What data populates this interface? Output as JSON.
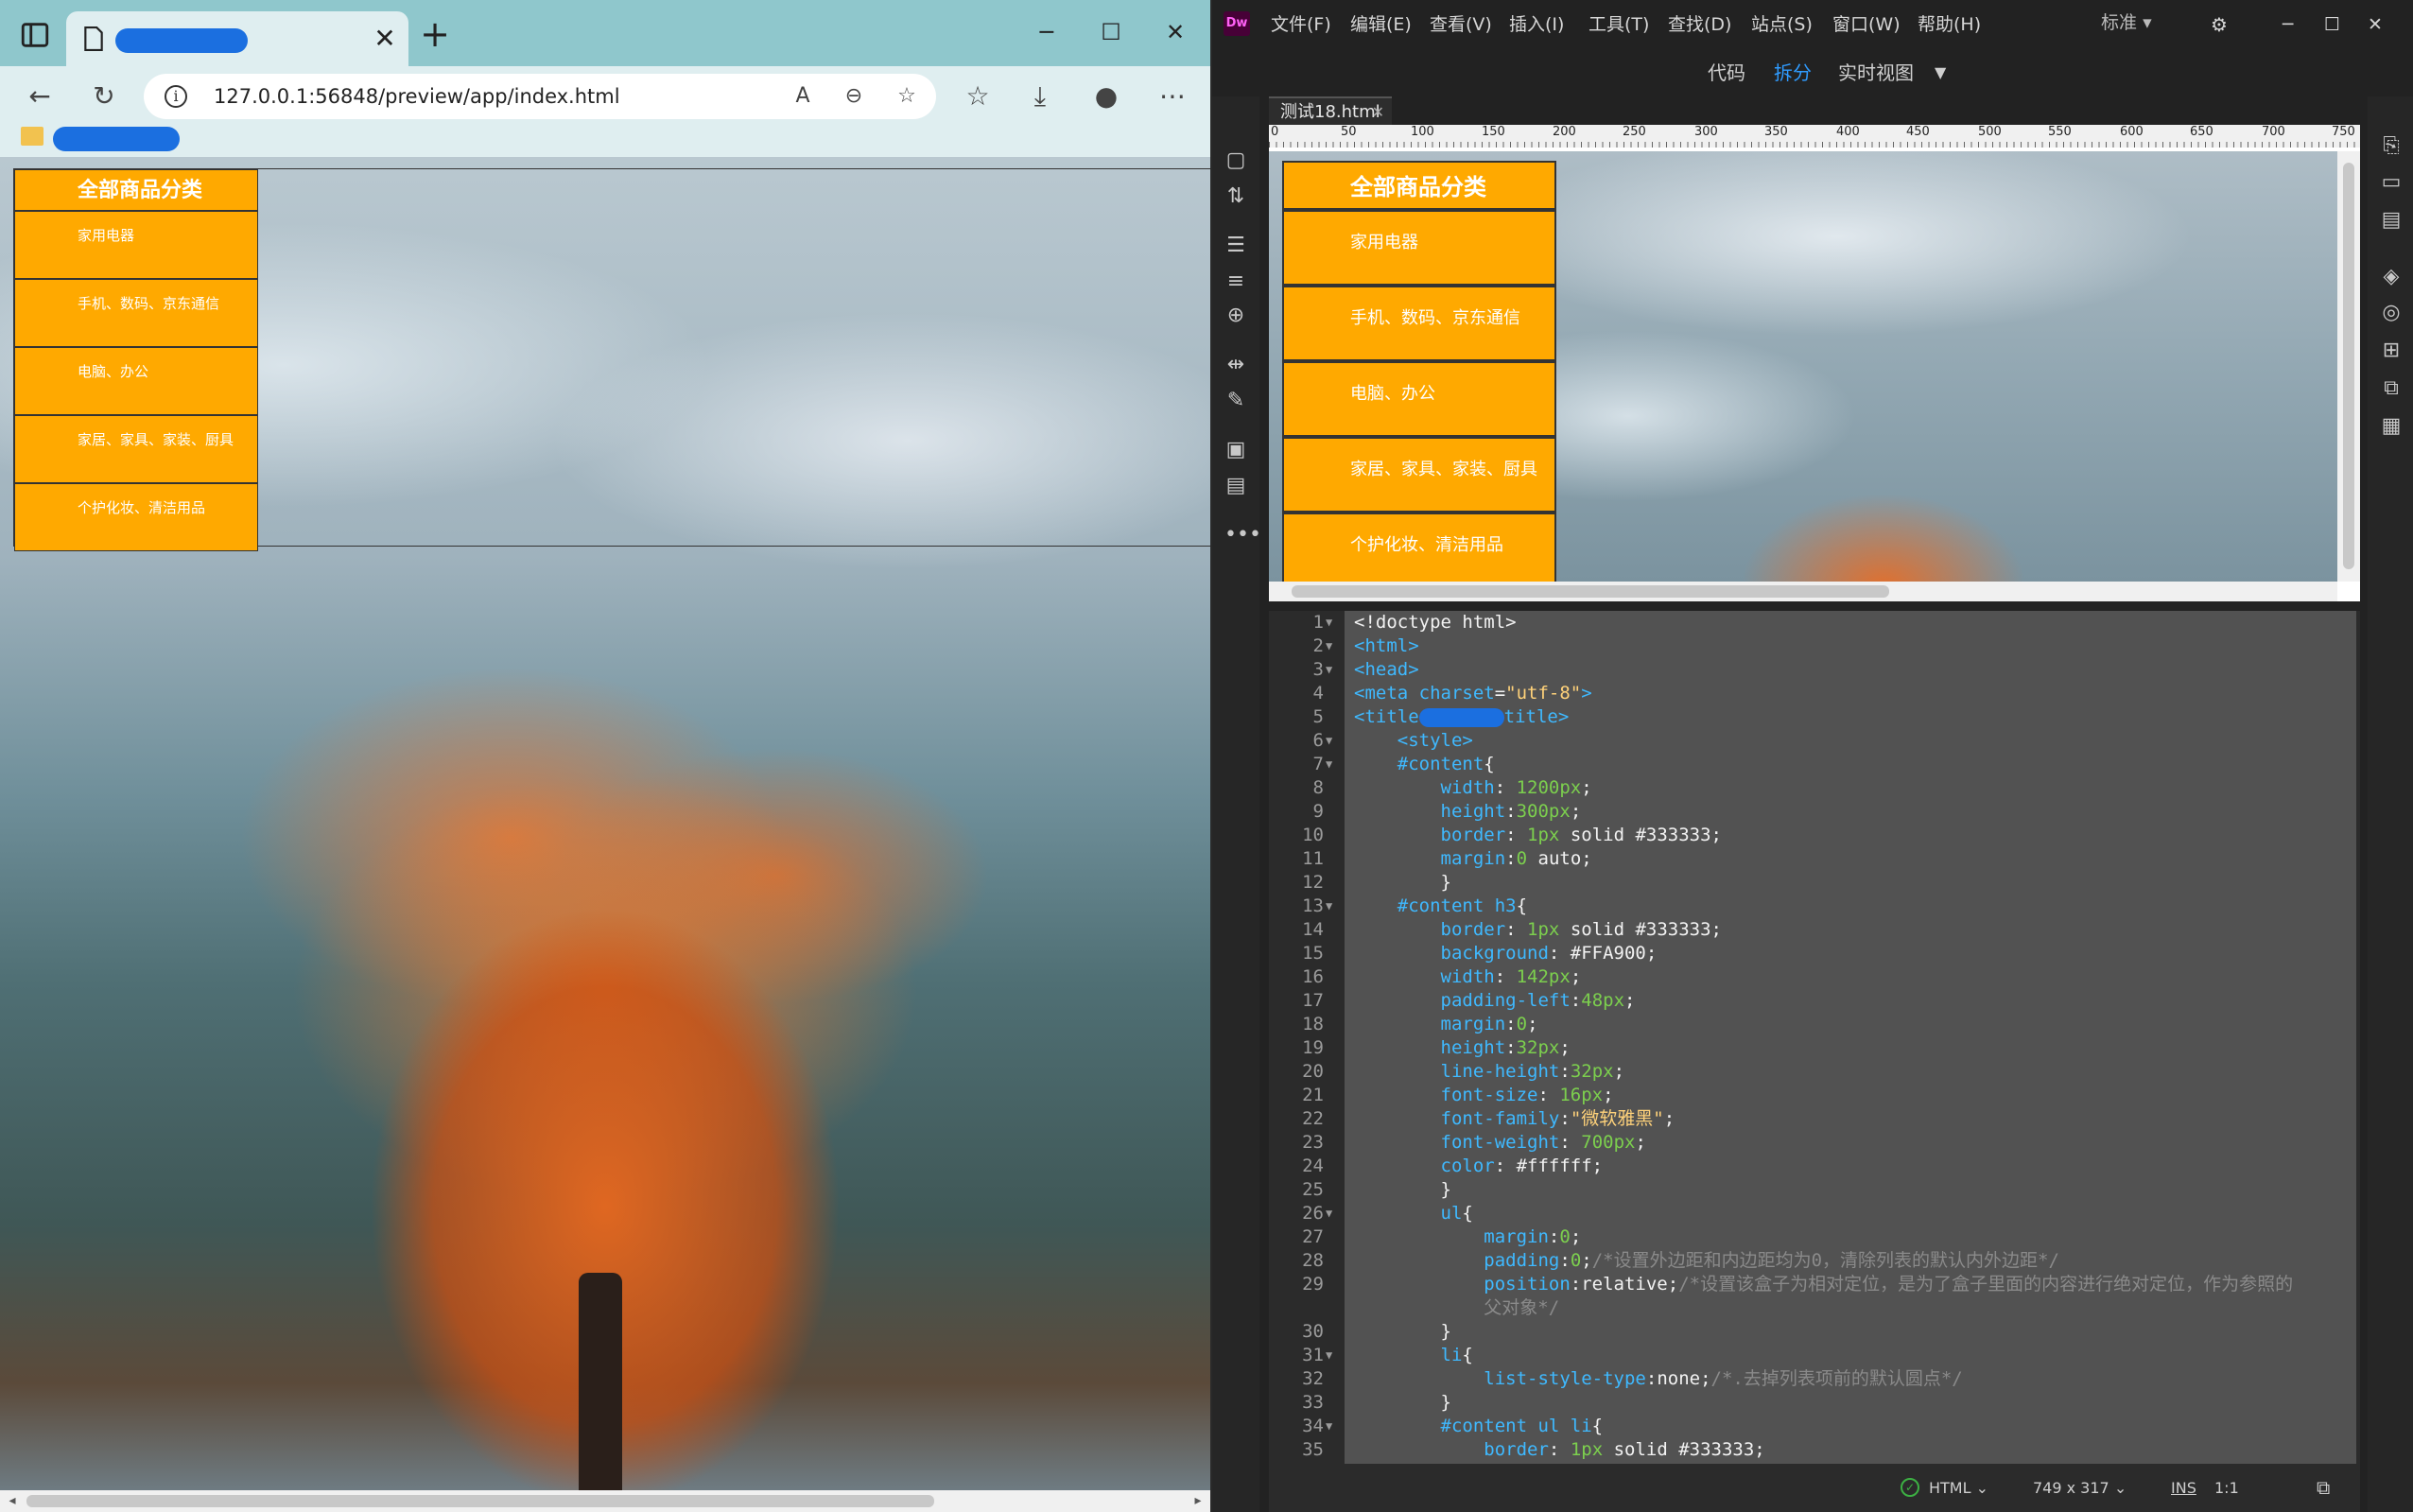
{
  "browser": {
    "address_url": "127.0.0.1:56848/preview/app/index.html",
    "tab_close": "✕",
    "new_tab": "+",
    "win_min": "─",
    "win_max": "☐",
    "win_close": "✕",
    "icons": {
      "back": "back-arrow-icon",
      "refresh": "refresh-icon",
      "info": "site-info-icon",
      "read_aloud": "read-aloud-icon",
      "zoom": "zoom-out-icon",
      "favorite": "add-favorite-icon",
      "favorites": "favorites-icon",
      "download": "download-icon",
      "profile": "profile-icon",
      "more": "more-icon"
    }
  },
  "page": {
    "heading": "全部商品分类",
    "items": [
      "家用电器",
      "手机、数码、京东通信",
      "电脑、办公",
      "家居、家具、家装、厨具",
      "个护化妆、清洁用品"
    ],
    "colors": {
      "nav_bg": "#FFA900",
      "border": "#333333",
      "text": "#ffffff"
    }
  },
  "dw": {
    "menus": [
      "文件(F)",
      "编辑(E)",
      "查看(V)",
      "插入(I)",
      "工具(T)",
      "查找(D)",
      "站点(S)",
      "窗口(W)",
      "帮助(H)"
    ],
    "workspace": "标准",
    "views": [
      "代码",
      "拆分",
      "实时视图"
    ],
    "active_view": "拆分",
    "doc_tab": "测试18.html",
    "ruler_ticks": [
      "0",
      "50",
      "100",
      "150",
      "200",
      "250",
      "300",
      "350",
      "400",
      "450",
      "500",
      "550",
      "600",
      "650",
      "700",
      "750"
    ],
    "status": {
      "language": "HTML",
      "dimensions": "749 x 317",
      "mode": "INS",
      "position": "1:1"
    },
    "code_lines": [
      {
        "n": "1",
        "fold": true,
        "parts": [
          [
            "t-white",
            "<!doctype html>"
          ]
        ]
      },
      {
        "n": "2",
        "fold": true,
        "parts": [
          [
            "t-tag",
            "<html>"
          ]
        ]
      },
      {
        "n": "3",
        "fold": true,
        "parts": [
          [
            "t-tag",
            "<head>"
          ]
        ]
      },
      {
        "n": "4",
        "fold": false,
        "parts": [
          [
            "t-tag",
            "<meta "
          ],
          [
            "t-prop",
            "charset"
          ],
          [
            "t-white",
            "="
          ],
          [
            "t-str",
            "\"utf-8\""
          ],
          [
            "t-tag",
            ">"
          ]
        ]
      },
      {
        "n": "5",
        "fold": false,
        "parts": [
          [
            "t-tag",
            "<title"
          ],
          [
            "redact",
            ""
          ],
          [
            "t-tag",
            "title>"
          ]
        ]
      },
      {
        "n": "6",
        "fold": true,
        "parts": [
          [
            "t-white",
            "    "
          ],
          [
            "t-tag",
            "<style>"
          ]
        ]
      },
      {
        "n": "7",
        "fold": true,
        "parts": [
          [
            "t-white",
            "    "
          ],
          [
            "t-tag",
            "#content"
          ],
          [
            "t-white",
            "{"
          ]
        ]
      },
      {
        "n": "8",
        "fold": false,
        "parts": [
          [
            "t-white",
            "        "
          ],
          [
            "t-prop",
            "width"
          ],
          [
            "t-white",
            ": "
          ],
          [
            "t-num",
            "1200px"
          ],
          [
            "t-white",
            ";"
          ]
        ]
      },
      {
        "n": "9",
        "fold": false,
        "parts": [
          [
            "t-white",
            "        "
          ],
          [
            "t-prop",
            "height"
          ],
          [
            "t-white",
            ":"
          ],
          [
            "t-num",
            "300px"
          ],
          [
            "t-white",
            ";"
          ]
        ]
      },
      {
        "n": "10",
        "fold": false,
        "parts": [
          [
            "t-white",
            "        "
          ],
          [
            "t-prop",
            "border"
          ],
          [
            "t-white",
            ": "
          ],
          [
            "t-num",
            "1px"
          ],
          [
            "t-white",
            " solid #333333;"
          ]
        ]
      },
      {
        "n": "11",
        "fold": false,
        "parts": [
          [
            "t-white",
            "        "
          ],
          [
            "t-prop",
            "margin"
          ],
          [
            "t-white",
            ":"
          ],
          [
            "t-num",
            "0"
          ],
          [
            "t-white",
            " auto;"
          ]
        ]
      },
      {
        "n": "12",
        "fold": false,
        "parts": [
          [
            "t-white",
            "        }"
          ]
        ]
      },
      {
        "n": "13",
        "fold": true,
        "parts": [
          [
            "t-white",
            "    "
          ],
          [
            "t-tag",
            "#content h3"
          ],
          [
            "t-white",
            "{"
          ]
        ]
      },
      {
        "n": "14",
        "fold": false,
        "parts": [
          [
            "t-white",
            "        "
          ],
          [
            "t-prop",
            "border"
          ],
          [
            "t-white",
            ": "
          ],
          [
            "t-num",
            "1px"
          ],
          [
            "t-white",
            " solid #333333;"
          ]
        ]
      },
      {
        "n": "15",
        "fold": false,
        "parts": [
          [
            "t-white",
            "        "
          ],
          [
            "t-prop",
            "background"
          ],
          [
            "t-white",
            ": #FFA900;"
          ]
        ]
      },
      {
        "n": "16",
        "fold": false,
        "parts": [
          [
            "t-white",
            "        "
          ],
          [
            "t-prop",
            "width"
          ],
          [
            "t-white",
            ": "
          ],
          [
            "t-num",
            "142px"
          ],
          [
            "t-white",
            ";"
          ]
        ]
      },
      {
        "n": "17",
        "fold": false,
        "parts": [
          [
            "t-white",
            "        "
          ],
          [
            "t-prop",
            "padding-left"
          ],
          [
            "t-white",
            ":"
          ],
          [
            "t-num",
            "48px"
          ],
          [
            "t-white",
            ";"
          ]
        ]
      },
      {
        "n": "18",
        "fold": false,
        "parts": [
          [
            "t-white",
            "        "
          ],
          [
            "t-prop",
            "margin"
          ],
          [
            "t-white",
            ":"
          ],
          [
            "t-num",
            "0"
          ],
          [
            "t-white",
            ";"
          ]
        ]
      },
      {
        "n": "19",
        "fold": false,
        "parts": [
          [
            "t-white",
            "        "
          ],
          [
            "t-prop",
            "height"
          ],
          [
            "t-white",
            ":"
          ],
          [
            "t-num",
            "32px"
          ],
          [
            "t-white",
            ";"
          ]
        ]
      },
      {
        "n": "20",
        "fold": false,
        "parts": [
          [
            "t-white",
            "        "
          ],
          [
            "t-prop",
            "line-height"
          ],
          [
            "t-white",
            ":"
          ],
          [
            "t-num",
            "32px"
          ],
          [
            "t-white",
            ";"
          ]
        ]
      },
      {
        "n": "21",
        "fold": false,
        "parts": [
          [
            "t-white",
            "        "
          ],
          [
            "t-prop",
            "font-size"
          ],
          [
            "t-white",
            ": "
          ],
          [
            "t-num",
            "16px"
          ],
          [
            "t-white",
            ";"
          ]
        ]
      },
      {
        "n": "22",
        "fold": false,
        "parts": [
          [
            "t-white",
            "        "
          ],
          [
            "t-prop",
            "font-family"
          ],
          [
            "t-white",
            ":"
          ],
          [
            "t-str",
            "\"微软雅黑\""
          ],
          [
            "t-white",
            ";"
          ]
        ]
      },
      {
        "n": "23",
        "fold": false,
        "parts": [
          [
            "t-white",
            "        "
          ],
          [
            "t-prop",
            "font-weight"
          ],
          [
            "t-white",
            ": "
          ],
          [
            "t-num",
            "700px"
          ],
          [
            "t-white",
            ";"
          ]
        ]
      },
      {
        "n": "24",
        "fold": false,
        "parts": [
          [
            "t-white",
            "        "
          ],
          [
            "t-prop",
            "color"
          ],
          [
            "t-white",
            ": #ffffff;"
          ]
        ]
      },
      {
        "n": "25",
        "fold": false,
        "parts": [
          [
            "t-white",
            "        }"
          ]
        ]
      },
      {
        "n": "26",
        "fold": true,
        "parts": [
          [
            "t-white",
            "        "
          ],
          [
            "t-tag",
            "ul"
          ],
          [
            "t-white",
            "{"
          ]
        ]
      },
      {
        "n": "27",
        "fold": false,
        "parts": [
          [
            "t-white",
            "            "
          ],
          [
            "t-prop",
            "margin"
          ],
          [
            "t-white",
            ":"
          ],
          [
            "t-num",
            "0"
          ],
          [
            "t-white",
            ";"
          ]
        ]
      },
      {
        "n": "28",
        "fold": false,
        "parts": [
          [
            "t-white",
            "            "
          ],
          [
            "t-prop",
            "padding"
          ],
          [
            "t-white",
            ":"
          ],
          [
            "t-num",
            "0"
          ],
          [
            "t-white",
            ";"
          ],
          [
            "t-cmt",
            "/*设置外边距和内边距均为0，清除列表的默认内外边距*/"
          ]
        ]
      },
      {
        "n": "29",
        "fold": false,
        "parts": [
          [
            "t-white",
            "            "
          ],
          [
            "t-prop",
            "position"
          ],
          [
            "t-white",
            ":relative;"
          ],
          [
            "t-cmt",
            "/*设置该盒子为相对定位，是为了盒子里面的内容进行绝对定位，作为参照的"
          ]
        ]
      },
      {
        "n": "",
        "fold": false,
        "parts": [
          [
            "t-cmt",
            "            父对象*/"
          ]
        ]
      },
      {
        "n": "30",
        "fold": false,
        "parts": [
          [
            "t-white",
            "        }"
          ]
        ]
      },
      {
        "n": "31",
        "fold": true,
        "parts": [
          [
            "t-white",
            "        "
          ],
          [
            "t-tag",
            "li"
          ],
          [
            "t-white",
            "{"
          ]
        ]
      },
      {
        "n": "32",
        "fold": false,
        "parts": [
          [
            "t-white",
            "            "
          ],
          [
            "t-prop",
            "list-style-type"
          ],
          [
            "t-white",
            ":none;"
          ],
          [
            "t-cmt",
            "/*.去掉列表项前的默认圆点*/"
          ]
        ]
      },
      {
        "n": "33",
        "fold": false,
        "parts": [
          [
            "t-white",
            "        }"
          ]
        ]
      },
      {
        "n": "34",
        "fold": true,
        "parts": [
          [
            "t-white",
            "        "
          ],
          [
            "t-tag",
            "#content ul li"
          ],
          [
            "t-white",
            "{"
          ]
        ]
      },
      {
        "n": "35",
        "fold": false,
        "parts": [
          [
            "t-white",
            "            "
          ],
          [
            "t-prop",
            "border"
          ],
          [
            "t-white",
            ": "
          ],
          [
            "t-num",
            "1px"
          ],
          [
            "t-white",
            " solid #333333;"
          ]
        ]
      }
    ]
  }
}
